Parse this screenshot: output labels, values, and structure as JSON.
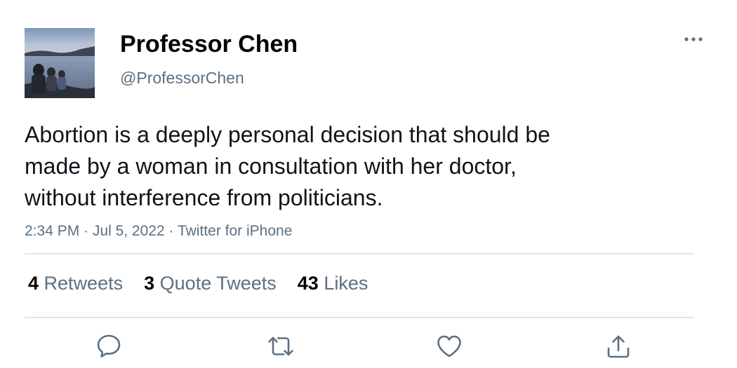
{
  "author": {
    "display_name": "Professor Chen",
    "handle": "@ProfessorChen"
  },
  "tweet": {
    "text_lines": [
      "Abortion is a deeply personal decision that should be",
      "made by a woman in consultation with her doctor,",
      "without interference from politicians."
    ],
    "time": "2:34 PM",
    "separator": "·",
    "date": "Jul 5, 2022",
    "source": "Twitter for iPhone"
  },
  "stats": {
    "retweets": {
      "count": "4",
      "label": "Retweets"
    },
    "quote_tweets": {
      "count": "3",
      "label": "Quote Tweets"
    },
    "likes": {
      "count": "43",
      "label": "Likes"
    }
  },
  "actions": [
    {
      "icon": "reply-icon"
    },
    {
      "icon": "retweet-icon"
    },
    {
      "icon": "like-heart-icon"
    },
    {
      "icon": "share-icon"
    }
  ],
  "colors": {
    "text_primary": "#0f1419",
    "text_secondary": "#5b7083",
    "divider": "#e1e4e6"
  }
}
